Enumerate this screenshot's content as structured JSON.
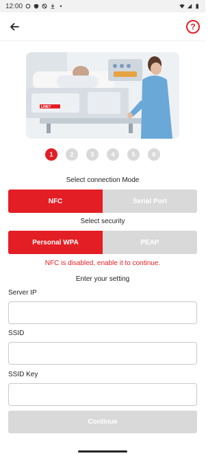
{
  "status_bar": {
    "time": "12:00",
    "icons": [
      "notification-icon",
      "shield-icon",
      "block-icon",
      "download-icon",
      "wifi-icon",
      "signal-icon",
      "battery-icon"
    ]
  },
  "app_bar": {
    "back_icon": "arrow-left-icon",
    "help_icon": "question-circle-icon",
    "help_glyph": "?"
  },
  "hero_image": {
    "subject": "nurse attending patient in hospital bed",
    "bed_brand": "LINET"
  },
  "stepper": {
    "steps": [
      "1",
      "2",
      "3",
      "4",
      "5",
      "6"
    ],
    "active_index": 0
  },
  "connection_mode": {
    "label": "Select connection Mode",
    "options": [
      "NFC",
      "Serial Port"
    ],
    "selected_index": 0
  },
  "security": {
    "label": "Select security",
    "options": [
      "Personal WPA",
      "PEAP"
    ],
    "selected_index": 0
  },
  "error_message": "NFC is disabled, enable it to continue.",
  "settings": {
    "label": "Enter your setting",
    "fields": [
      {
        "label": "Server IP",
        "value": ""
      },
      {
        "label": "SSID",
        "value": ""
      },
      {
        "label": "SSID Key",
        "value": ""
      }
    ]
  },
  "continue_button": {
    "label": "Continue",
    "enabled": false
  },
  "colors": {
    "accent": "#e31e24",
    "inactive": "#d9d9d9",
    "text": "#222222"
  }
}
